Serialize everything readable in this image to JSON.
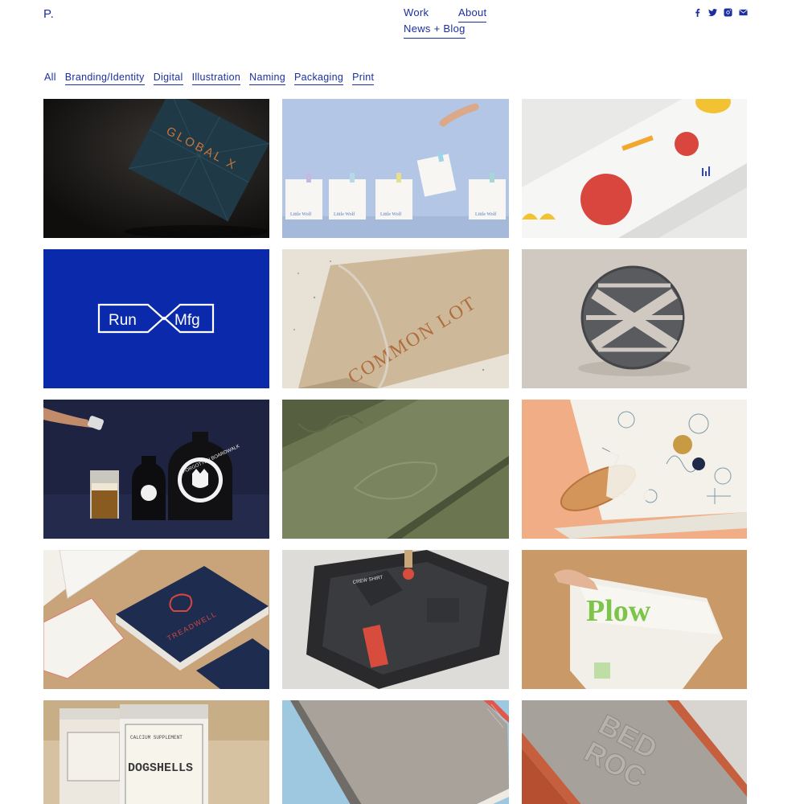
{
  "logo": "P.",
  "nav": {
    "work": "Work",
    "about": "About",
    "news": "News + Blog"
  },
  "social": [
    "facebook-icon",
    "twitter-icon",
    "instagram-icon",
    "email-icon"
  ],
  "filters": [
    {
      "label": "All",
      "active": true
    },
    {
      "label": "Branding/Identity"
    },
    {
      "label": "Digital"
    },
    {
      "label": "Illustration"
    },
    {
      "label": "Naming"
    },
    {
      "label": "Packaging"
    },
    {
      "label": "Print"
    }
  ],
  "tiles": [
    {
      "id": "global-x",
      "text": "GLOBAL X"
    },
    {
      "id": "little-wolf",
      "text": "Little Wolf"
    },
    {
      "id": "colorful-box",
      "text": ""
    },
    {
      "id": "run-mfg",
      "text_left": "Run",
      "text_right": "Mfg"
    },
    {
      "id": "common-lot",
      "text": "COMMON LOT"
    },
    {
      "id": "gray-emblem",
      "text": ""
    },
    {
      "id": "forgotten-boardwalk",
      "text": "FORGOTTEN BOARDWALK"
    },
    {
      "id": "green-folder",
      "text": ""
    },
    {
      "id": "bread-wrap",
      "text": ""
    },
    {
      "id": "treadwell",
      "text": "TREADWELL"
    },
    {
      "id": "crew-shirt",
      "text": "CREW SHIRT"
    },
    {
      "id": "plow",
      "text": "Plow"
    },
    {
      "id": "dogshells",
      "text": "DOGSHELLS",
      "sub": "CALCIUM SUPPLEMENT"
    },
    {
      "id": "notebook",
      "text": ""
    },
    {
      "id": "bedroc",
      "text_top": "BED",
      "text_bottom": "ROC"
    }
  ]
}
